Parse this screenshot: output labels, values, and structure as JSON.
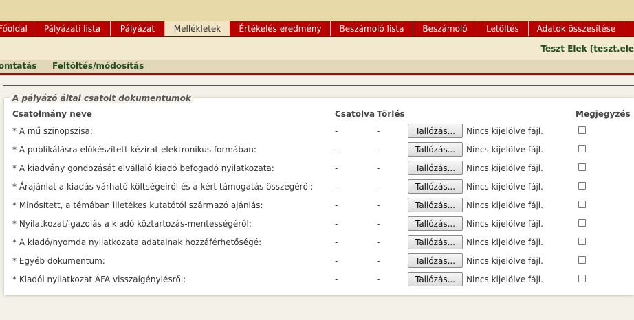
{
  "nav": {
    "tabs": [
      {
        "label": "Főoldal"
      },
      {
        "label": "Pályázati lista"
      },
      {
        "label": "Pályázat"
      },
      {
        "label": "Mellékletek",
        "active": true
      },
      {
        "label": "Értékelés eredmény"
      },
      {
        "label": "Beszámoló lista"
      },
      {
        "label": "Beszámoló"
      },
      {
        "label": "Letöltés"
      },
      {
        "label": "Adatok összesítése"
      }
    ]
  },
  "user": {
    "name": "Teszt Elek [teszt.ele"
  },
  "subnav": {
    "items": [
      "Nyomtatás",
      "Feltöltés/módosítás"
    ]
  },
  "attachments": {
    "legend": "A pályázó által csatolt dokumentumok",
    "headers": {
      "name": "Csatolmány neve",
      "attached": "Csatolva",
      "delete": "Törlés",
      "note": "Megjegyzés"
    },
    "browse_label": "Tallózás...",
    "no_file_label": "Nincs kijelölve fájl.",
    "rows": [
      {
        "name": "* A mű szinopszisa:",
        "attached": "-",
        "delete": "-",
        "checked": false
      },
      {
        "name": "* A publikálásra előkészített kézirat elektronikus formában:",
        "attached": "-",
        "delete": "-",
        "checked": false
      },
      {
        "name": "* A kiadvány gondozását elvállaló kiadó befogadó nyilatkozata:",
        "attached": "-",
        "delete": "-",
        "checked": false
      },
      {
        "name": "* Árajánlat a kiadás várható költségeiről és a kért támogatás összegéről:",
        "attached": "-",
        "delete": "-",
        "checked": false
      },
      {
        "name": "* Minősített, a témában illetékes kutatótól származó ajánlás:",
        "attached": "-",
        "delete": "-",
        "checked": false
      },
      {
        "name": "* Nyilatkozat/igazolás a kiadó köztartozás-mentességéről:",
        "attached": "-",
        "delete": "-",
        "checked": false
      },
      {
        "name": "* A kiadó/nyomda nyilatkozata adatainak hozzáférhetőségé:",
        "attached": "-",
        "delete": "-",
        "checked": false
      },
      {
        "name": "* Egyéb dokumentum:",
        "attached": "-",
        "delete": "-",
        "checked": false
      },
      {
        "name": "* Kiadói nyilatkozat ÁFA visszaigénylésről:",
        "attached": "-",
        "delete": "-",
        "checked": false
      }
    ]
  }
}
